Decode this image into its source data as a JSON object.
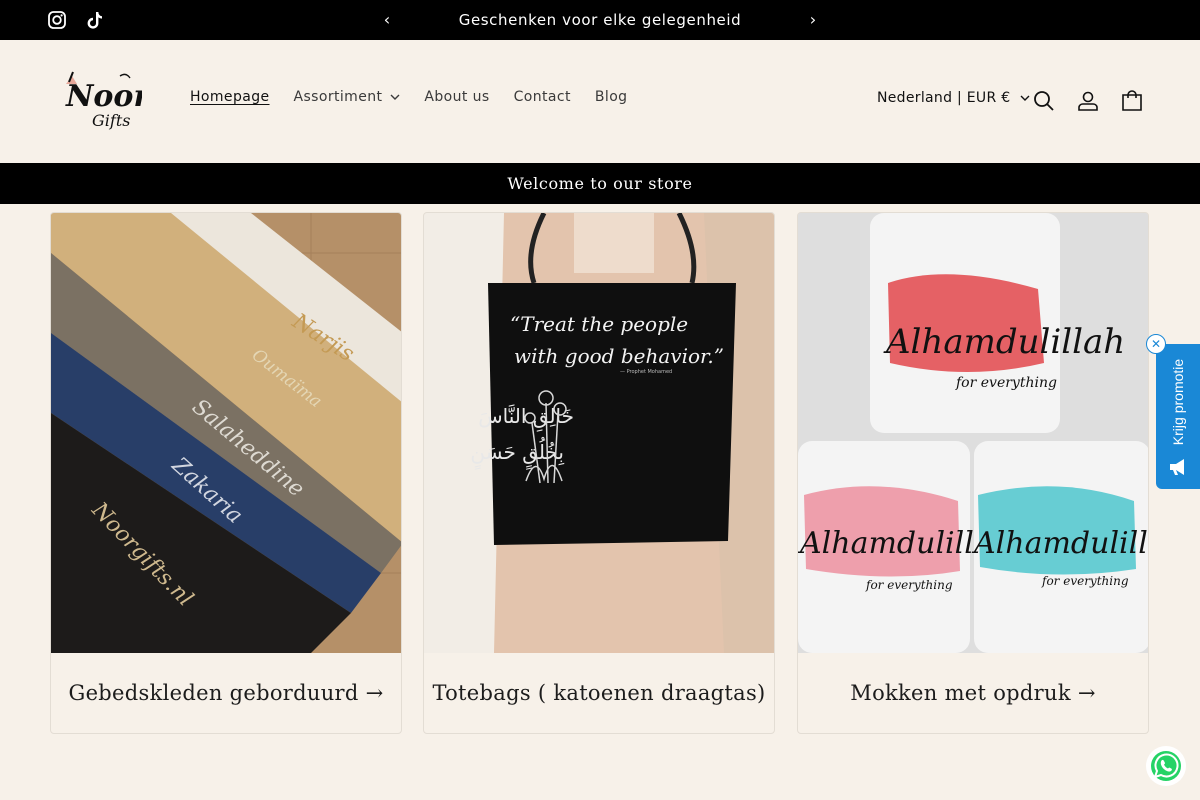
{
  "announcement": {
    "text": "Geschenken voor elke gelegenheid",
    "prev_icon": "chevron-left-icon",
    "next_icon": "chevron-right-icon"
  },
  "social": [
    "instagram-icon",
    "tiktok-icon"
  ],
  "header": {
    "logo_text": "Noor Gifts",
    "nav": [
      {
        "label": "Homepage",
        "active": true
      },
      {
        "label": "Assortiment",
        "has_dropdown": true
      },
      {
        "label": "About us"
      },
      {
        "label": "Contact"
      },
      {
        "label": "Blog"
      }
    ],
    "country_selector": "Nederland | EUR €",
    "icons": [
      "search-icon",
      "account-icon",
      "cart-icon"
    ]
  },
  "welcome": "Welcome to our store",
  "collections": [
    {
      "title": "Gebedskleden geborduurd →",
      "names": [
        "Narjis",
        "Oumaïma",
        "Salaheddine",
        "Zakaria",
        "Noorgifts.nl"
      ]
    },
    {
      "title": "Totebags ( katoenen draagtas) →",
      "quote": "“Treat the people with good behavior.”",
      "quote_attribution": "— Prophet Mohamed",
      "arabic": "خَالِقِ النَّاسَ بِخُلُقٍ حَسَنٍ"
    },
    {
      "title": "Mokken met opdruk →",
      "mug_text": "Alhamdulillah",
      "mug_subtext": "for everything"
    }
  ],
  "promo": {
    "label": "Krijg promotie",
    "close_icon": "close-icon"
  },
  "colors": {
    "bg": "#f7f1e9",
    "bar": "#000000",
    "promo": "#1a88d6",
    "whatsapp": "#25d366"
  }
}
